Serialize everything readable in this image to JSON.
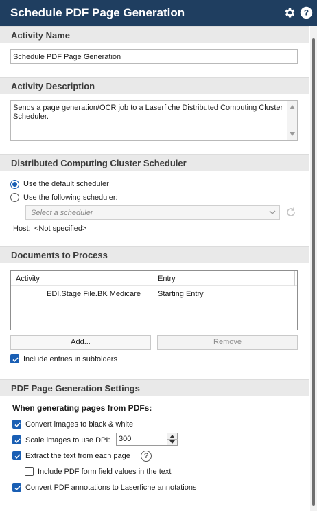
{
  "title": "Schedule PDF Page Generation",
  "title_bar": {
    "settings_icon": "gear-icon",
    "help_icon": "help-icon"
  },
  "activity_name": {
    "header": "Activity Name",
    "value": "Schedule PDF Page Generation"
  },
  "activity_description": {
    "header": "Activity Description",
    "value": "Sends a page generation/OCR job to a Laserfiche Distributed Computing Cluster Scheduler."
  },
  "scheduler": {
    "header": "Distributed Computing Cluster Scheduler",
    "option_default": "Use the default scheduler",
    "option_following": "Use the following scheduler:",
    "selected_option": "default",
    "select_placeholder": "Select a scheduler",
    "host_label": "Host:",
    "host_value": "<Not specified>"
  },
  "documents": {
    "header": "Documents to Process",
    "columns": [
      "Activity",
      "Entry"
    ],
    "rows": [
      {
        "activity": "EDI.Stage File.BK Medicare",
        "entry": "Starting Entry"
      }
    ],
    "add_button": "Add...",
    "remove_button": "Remove",
    "include_subfolders_label": "Include entries in subfolders",
    "include_subfolders_checked": true
  },
  "pdf_settings": {
    "header": "PDF Page Generation Settings",
    "subheader": "When generating pages from PDFs:",
    "convert_bw_label": "Convert images to black & white",
    "convert_bw_checked": true,
    "scale_dpi_label": "Scale images to use DPI:",
    "scale_dpi_checked": true,
    "dpi_value": "300",
    "extract_text_label": "Extract the text from each page",
    "extract_text_checked": true,
    "extract_text_help": "?",
    "form_fields_label": "Include PDF form field values in the text",
    "form_fields_checked": false,
    "annotations_label": "Convert PDF annotations to Laserfiche annotations",
    "annotations_checked": true
  },
  "colors": {
    "title_bar": "#1f3e60",
    "accent": "#1a5fb4",
    "section_header_bg": "#e9e9e9"
  }
}
